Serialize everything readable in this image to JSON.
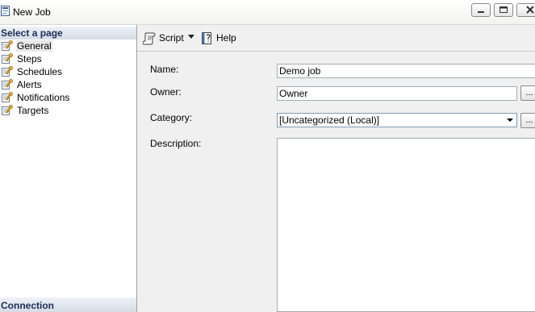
{
  "window": {
    "title": "New Job",
    "app_icon": "sql-job-icon",
    "controls": {
      "minimize": "minimize-icon",
      "restore": "restore-icon",
      "close": "close-icon"
    }
  },
  "left_pane": {
    "header": "Select a page",
    "items": [
      {
        "label": "General",
        "icon": "page-wrench-icon",
        "selected": true
      },
      {
        "label": "Steps",
        "icon": "page-wrench-icon",
        "selected": false
      },
      {
        "label": "Schedules",
        "icon": "page-wrench-icon",
        "selected": false
      },
      {
        "label": "Alerts",
        "icon": "page-wrench-icon",
        "selected": false
      },
      {
        "label": "Notifications",
        "icon": "page-wrench-icon",
        "selected": false
      },
      {
        "label": "Targets",
        "icon": "page-wrench-icon",
        "selected": false
      }
    ],
    "connection_header": "Connection"
  },
  "toolbar": {
    "script_label": "Script",
    "script_icon": "script-icon",
    "help_label": "Help",
    "help_icon": "help-icon"
  },
  "form": {
    "name_label": "Name:",
    "name_value": "Demo job",
    "owner_label": "Owner:",
    "owner_value": "Owner",
    "category_label": "Category:",
    "category_value": "[Uncategorized (Local)]",
    "description_label": "Description:",
    "description_value": "",
    "browse_button": "..."
  }
}
